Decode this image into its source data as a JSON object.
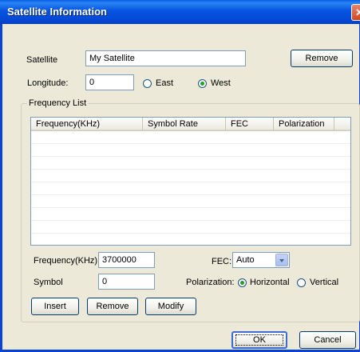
{
  "window": {
    "title": "Satellite Information",
    "close_glyph": "✕"
  },
  "satellite": {
    "label": "Satellite",
    "value": "My Satellite",
    "remove_label": "Remove"
  },
  "longitude": {
    "label": "Longitude:",
    "value": "0",
    "east_label": "East",
    "west_label": "West",
    "selected": "West"
  },
  "frequency_list": {
    "group_label": "Frequency List",
    "columns": [
      "Frequency(KHz)",
      "Symbol Rate",
      "FEC",
      "Polarization"
    ],
    "rows": []
  },
  "form": {
    "frequency_label": "Frequency(KHz):",
    "frequency_value": "3700000",
    "fec_label": "FEC:",
    "fec_value": "Auto",
    "symbol_label": "Symbol",
    "symbol_value": "0",
    "polarization_label": "Polarization:",
    "horizontal_label": "Horizontal",
    "vertical_label": "Vertical",
    "polarization_selected": "Horizontal"
  },
  "actions": {
    "insert": "Insert",
    "remove": "Remove",
    "modify": "Modify"
  },
  "footer": {
    "ok": "OK",
    "cancel": "Cancel"
  },
  "colors": {
    "titlebar": "#0654e0",
    "dialog_bg": "#ece9d8",
    "close_button": "#d2461f",
    "radio_dot": "#21a121"
  }
}
